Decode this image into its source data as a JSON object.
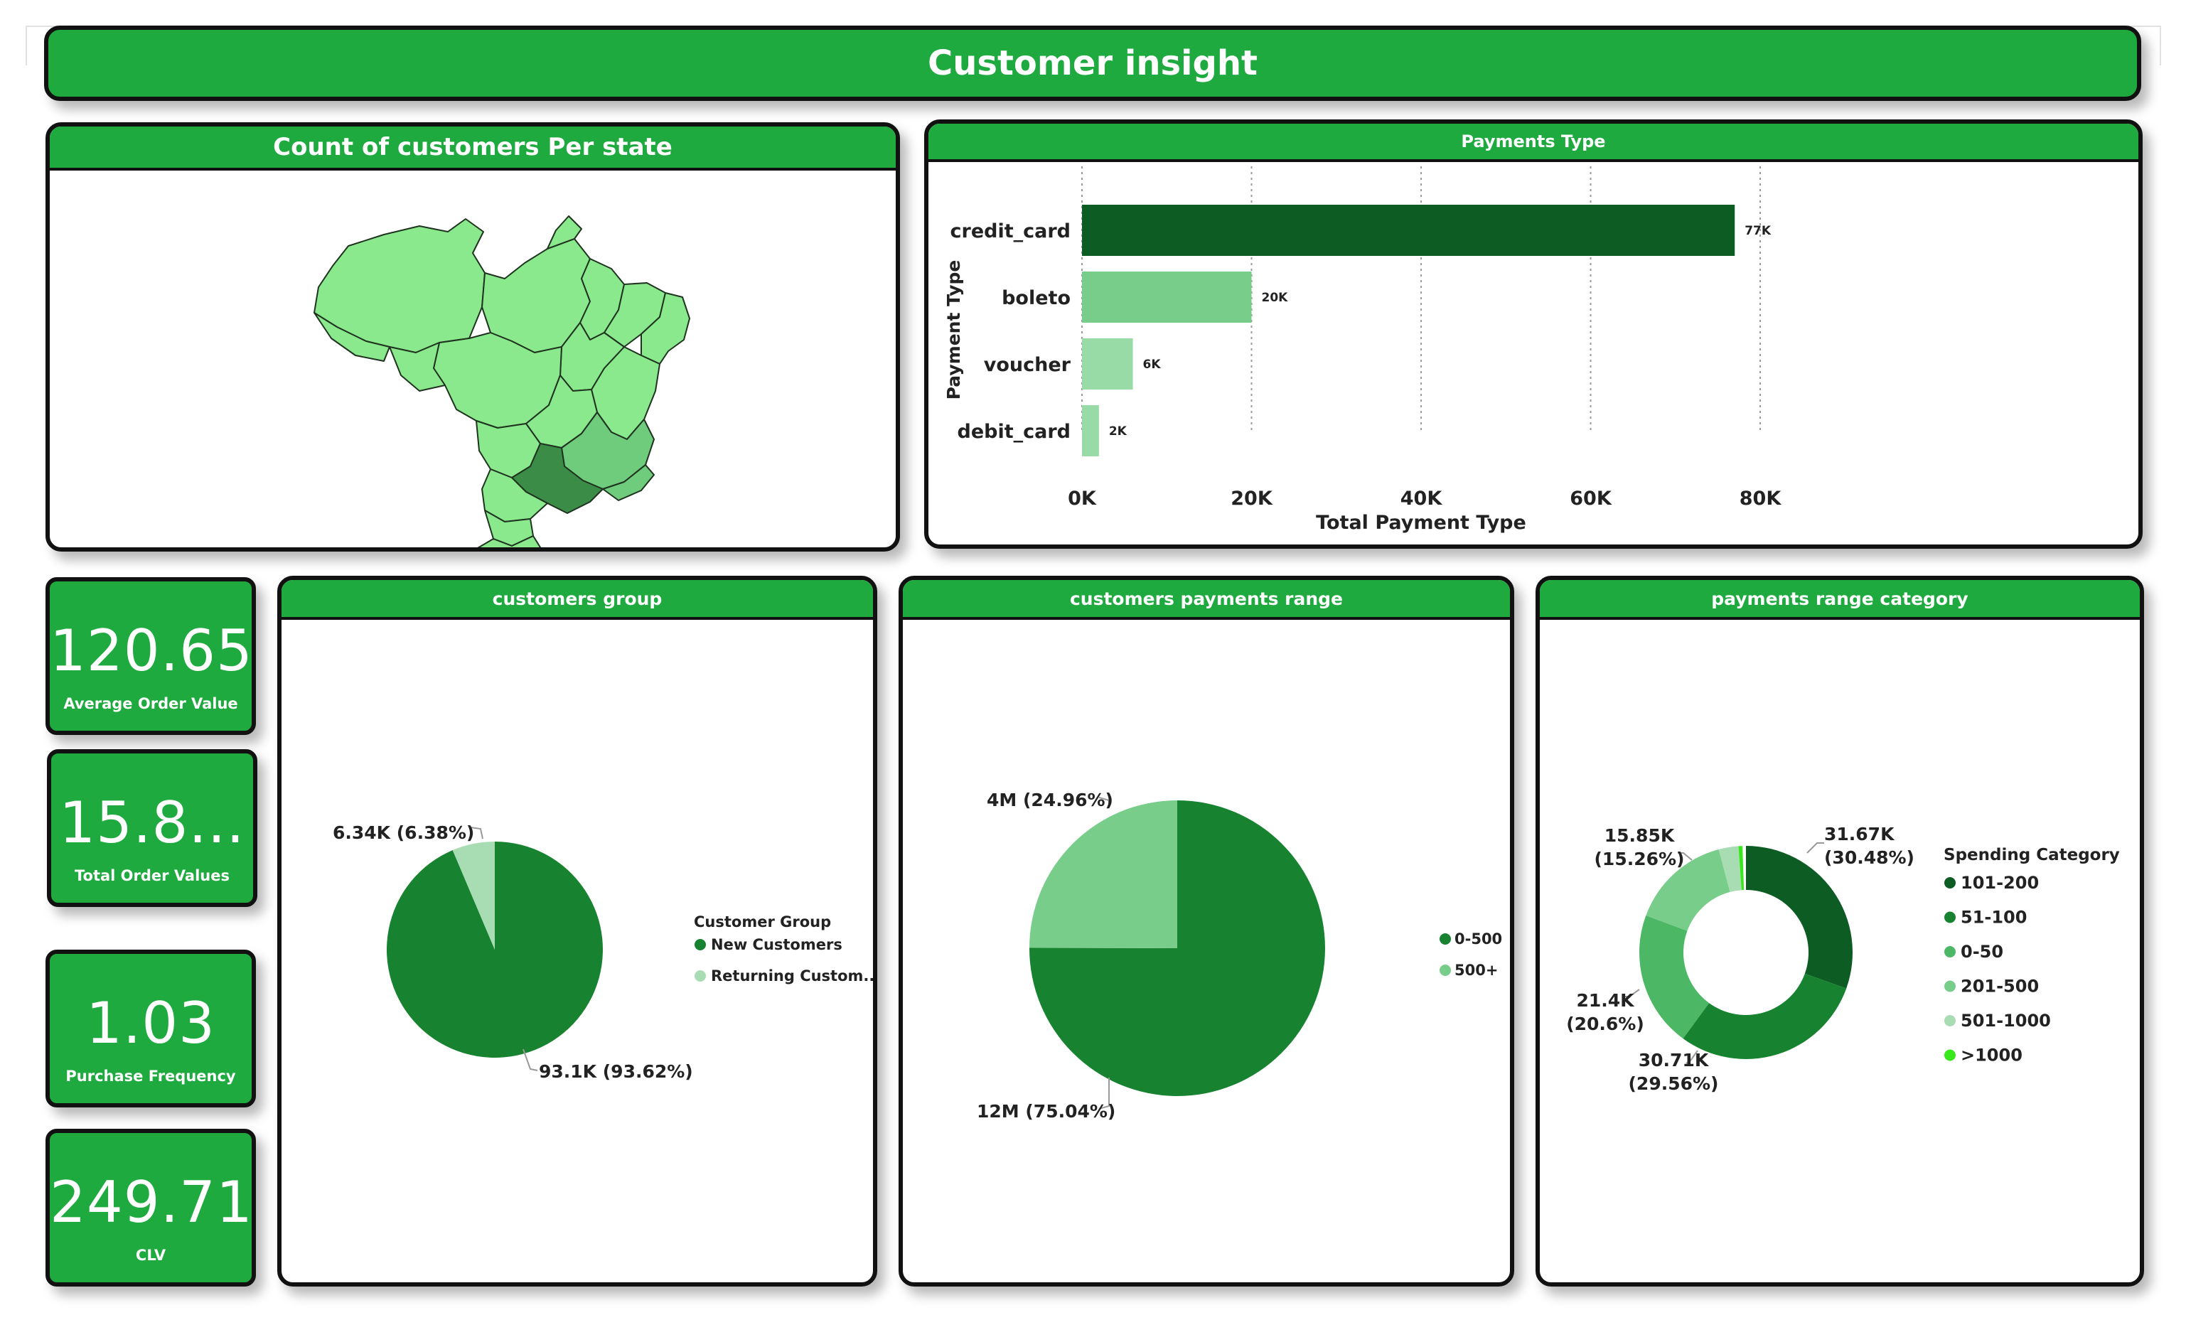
{
  "header": {
    "title": "Customer insight"
  },
  "map_panel": {
    "title": "Count of customers Per state"
  },
  "payments_panel": {
    "title": "Payments Type",
    "chart_data": {
      "type": "bar",
      "orientation": "horizontal",
      "categories": [
        "credit_card",
        "boleto",
        "voucher",
        "debit_card"
      ],
      "values": [
        77000,
        20000,
        6000,
        2000
      ],
      "data_labels": [
        "77K",
        "20K",
        "6K",
        "2K"
      ],
      "xlabel": "Total Payment Type",
      "ylabel": "Payment Type",
      "xlim": [
        0,
        80000
      ],
      "x_ticks": [
        "0K",
        "20K",
        "40K",
        "60K",
        "80K"
      ],
      "colors": [
        "#0d5c24",
        "#79cd8b",
        "#98dba7",
        "#98dba7"
      ],
      "grid": "vertical dotted"
    }
  },
  "kpis": [
    {
      "value": "120.65",
      "label": "Average Order Value"
    },
    {
      "value": "15.8...",
      "label": "Total Order Values"
    },
    {
      "value": "1.03",
      "label": "Purchase Frequency"
    },
    {
      "value": "249.71",
      "label": "CLV"
    }
  ],
  "group_panel": {
    "title": "customers group",
    "chart_data": {
      "type": "pie",
      "labels": [
        "New Customers",
        "Returning Custom..."
      ],
      "values": [
        93.1,
        6.34
      ],
      "percent": [
        93.62,
        6.38
      ],
      "data_labels": [
        "93.1K (93.62%)",
        "6.34K (6.38%)"
      ],
      "legend_title": "Customer Group",
      "legend_position": "right",
      "colors": [
        "#178330",
        "#a8ddb3"
      ]
    }
  },
  "range_panel": {
    "title": "customers payments range",
    "chart_data": {
      "type": "pie",
      "labels": [
        "0-500",
        "500+"
      ],
      "values": [
        12,
        4
      ],
      "percent": [
        75.04,
        24.96
      ],
      "data_labels": [
        "12M (75.04%)",
        "4M (24.96%)"
      ],
      "legend_position": "right",
      "colors": [
        "#178330",
        "#79cd8b"
      ]
    }
  },
  "category_panel": {
    "title": "payments range category",
    "chart_data": {
      "type": "donut",
      "labels": [
        "101-200",
        "51-100",
        "0-50",
        "201-500",
        "501-1000",
        ">1000"
      ],
      "percent": [
        30.48,
        29.56,
        20.6,
        15.26,
        2.98,
        0.6
      ],
      "data_labels": [
        [
          "31.67K",
          "(30.48%)"
        ],
        [
          "30.71K",
          "(29.56%)"
        ],
        [
          "21.4K",
          "(20.6%)"
        ],
        [
          "15.85K",
          "(15.26%)"
        ],
        null,
        null
      ],
      "legend_title": "Spending Category",
      "legend_position": "right",
      "colors": [
        "#0d5c24",
        "#178330",
        "#4cb865",
        "#79cd8b",
        "#a8ddb3",
        "#39e81c"
      ]
    }
  },
  "map_colors": {
    "dark": "#3b8c47",
    "medium": "#6fcc7c",
    "light": "#8ae98c",
    "stroke": "#1f3320"
  }
}
